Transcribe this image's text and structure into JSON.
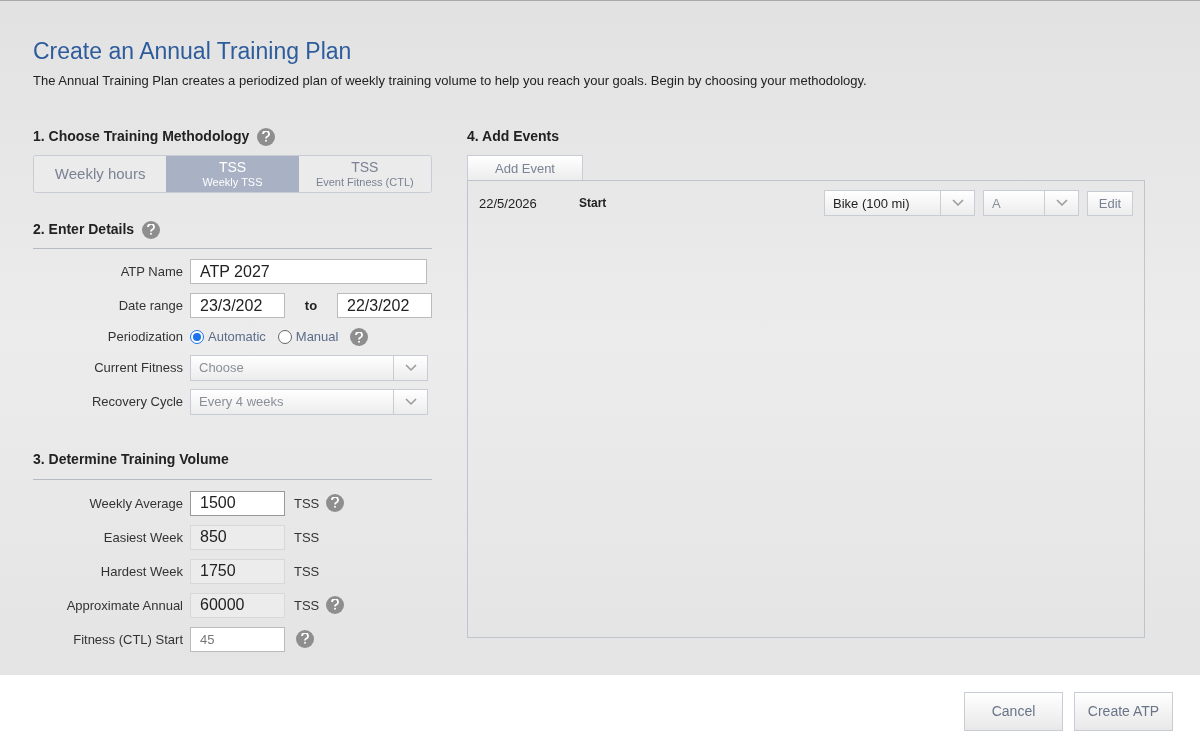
{
  "title": "Create an Annual Training Plan",
  "intro": "The Annual Training Plan creates a periodized plan of weekly training volume to help you reach your goals. Begin by choosing your methodology.",
  "methodology": {
    "heading": "1. Choose Training Methodology",
    "options": [
      {
        "label": "Weekly hours",
        "selected": false
      },
      {
        "label": "TSS",
        "sublabel": "Weekly TSS",
        "selected": true
      },
      {
        "label": "TSS",
        "sublabel": "Event Fitness (CTL)",
        "selected": false
      }
    ]
  },
  "details": {
    "heading": "2. Enter Details",
    "atp_name": {
      "label": "ATP Name",
      "value": "ATP 2027"
    },
    "date_range": {
      "label": "Date range",
      "from": "23/3/202",
      "separator": "to",
      "to": "22/3/202"
    },
    "periodization": {
      "label": "Periodization",
      "options": [
        {
          "label": "Automatic",
          "selected": true
        },
        {
          "label": "Manual",
          "selected": false
        }
      ]
    },
    "selects": [
      {
        "label": "Current Fitness",
        "value": "Choose"
      },
      {
        "label": "Recovery Cycle",
        "value": "Every 4 weeks"
      }
    ]
  },
  "volume": {
    "heading": "3. Determine Training Volume",
    "rows": [
      {
        "label": "Weekly Average",
        "value": "1500",
        "kind": "editable",
        "unit": "TSS",
        "help": true
      },
      {
        "label": "Easiest Week",
        "value": "850",
        "kind": "readonly",
        "unit": "TSS",
        "help": false
      },
      {
        "label": "Hardest Week",
        "value": "1750",
        "kind": "readonly",
        "unit": "TSS",
        "help": false
      },
      {
        "label": "Approximate Annual",
        "value": "60000",
        "kind": "readonly",
        "unit": "TSS",
        "help": true
      },
      {
        "label": "Fitness (CTL) Start",
        "placeholder": "45",
        "kind": "small",
        "help": true
      }
    ]
  },
  "events": {
    "heading": "4. Add Events",
    "add_button": "Add Event",
    "rows": [
      {
        "date": "22/5/2026",
        "name": "Start",
        "type": "Bike (100 mi)",
        "priority": "A",
        "edit": "Edit"
      }
    ]
  },
  "buttons": [
    "Cancel",
    "Create ATP"
  ]
}
